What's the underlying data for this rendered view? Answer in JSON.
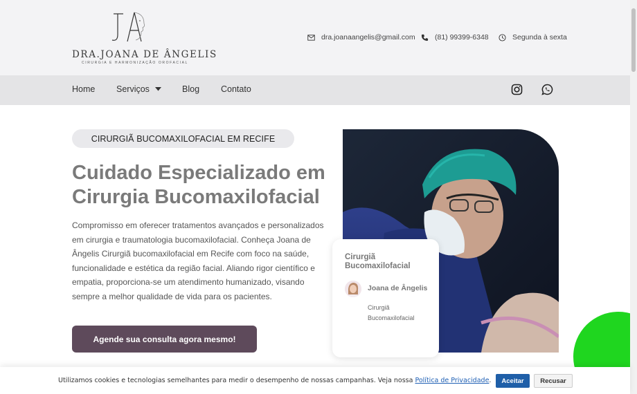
{
  "header": {
    "logo_name": "DRA.JOANA DE ÂNGELIS",
    "logo_subtitle": "CIRURGIA E HARMONIZAÇÃO OROFACIAL",
    "email": "dra.joanaangelis@gmail.com",
    "phone": "(81) 99399-6348",
    "hours": "Segunda à sexta"
  },
  "nav": {
    "items": [
      {
        "label": "Home"
      },
      {
        "label": "Serviços"
      },
      {
        "label": "Blog"
      },
      {
        "label": "Contato"
      }
    ],
    "social": [
      "instagram-icon",
      "whatsapp-icon"
    ]
  },
  "hero": {
    "tag": "CIRURGIÃ BUCOMAXILOFACIAL EM RECIFE",
    "title": "Cuidado Especializado em Cirurgia Bucomaxilofacial",
    "text": "Compromisso em oferecer tratamentos avançados e personalizados em cirurgia e traumatologia bucomaxilofacial. Conheça Joana de Ângelis Cirurgiã bucomaxilofacial em Recife com foco na saúde, funcionalidade e estética da região facial. Aliando rigor científico e empatia, proporciona-se um atendimento humanizado, visando sempre a melhor qualidade de vida para os pacientes.",
    "cta_label": "Agende sua consulta agora mesmo!"
  },
  "card": {
    "title": "Cirurgiã Bucomaxilofacial",
    "name": "Joana de Ângelis",
    "role": "Cirurgiã Bucomaxilofacial"
  },
  "cookie": {
    "text": "Utilizamos cookies e tecnologias semelhantes para medir o desempenho de nossas campanhas. Veja nossa ",
    "link_label": "Política de Privacidade",
    "suffix": ".",
    "accept_label": "Aceitar",
    "reject_label": "Recusar"
  },
  "colors": {
    "cta": "#5e4a5b",
    "accept": "#1f5fa8",
    "accent_green": "#1fd61f"
  }
}
